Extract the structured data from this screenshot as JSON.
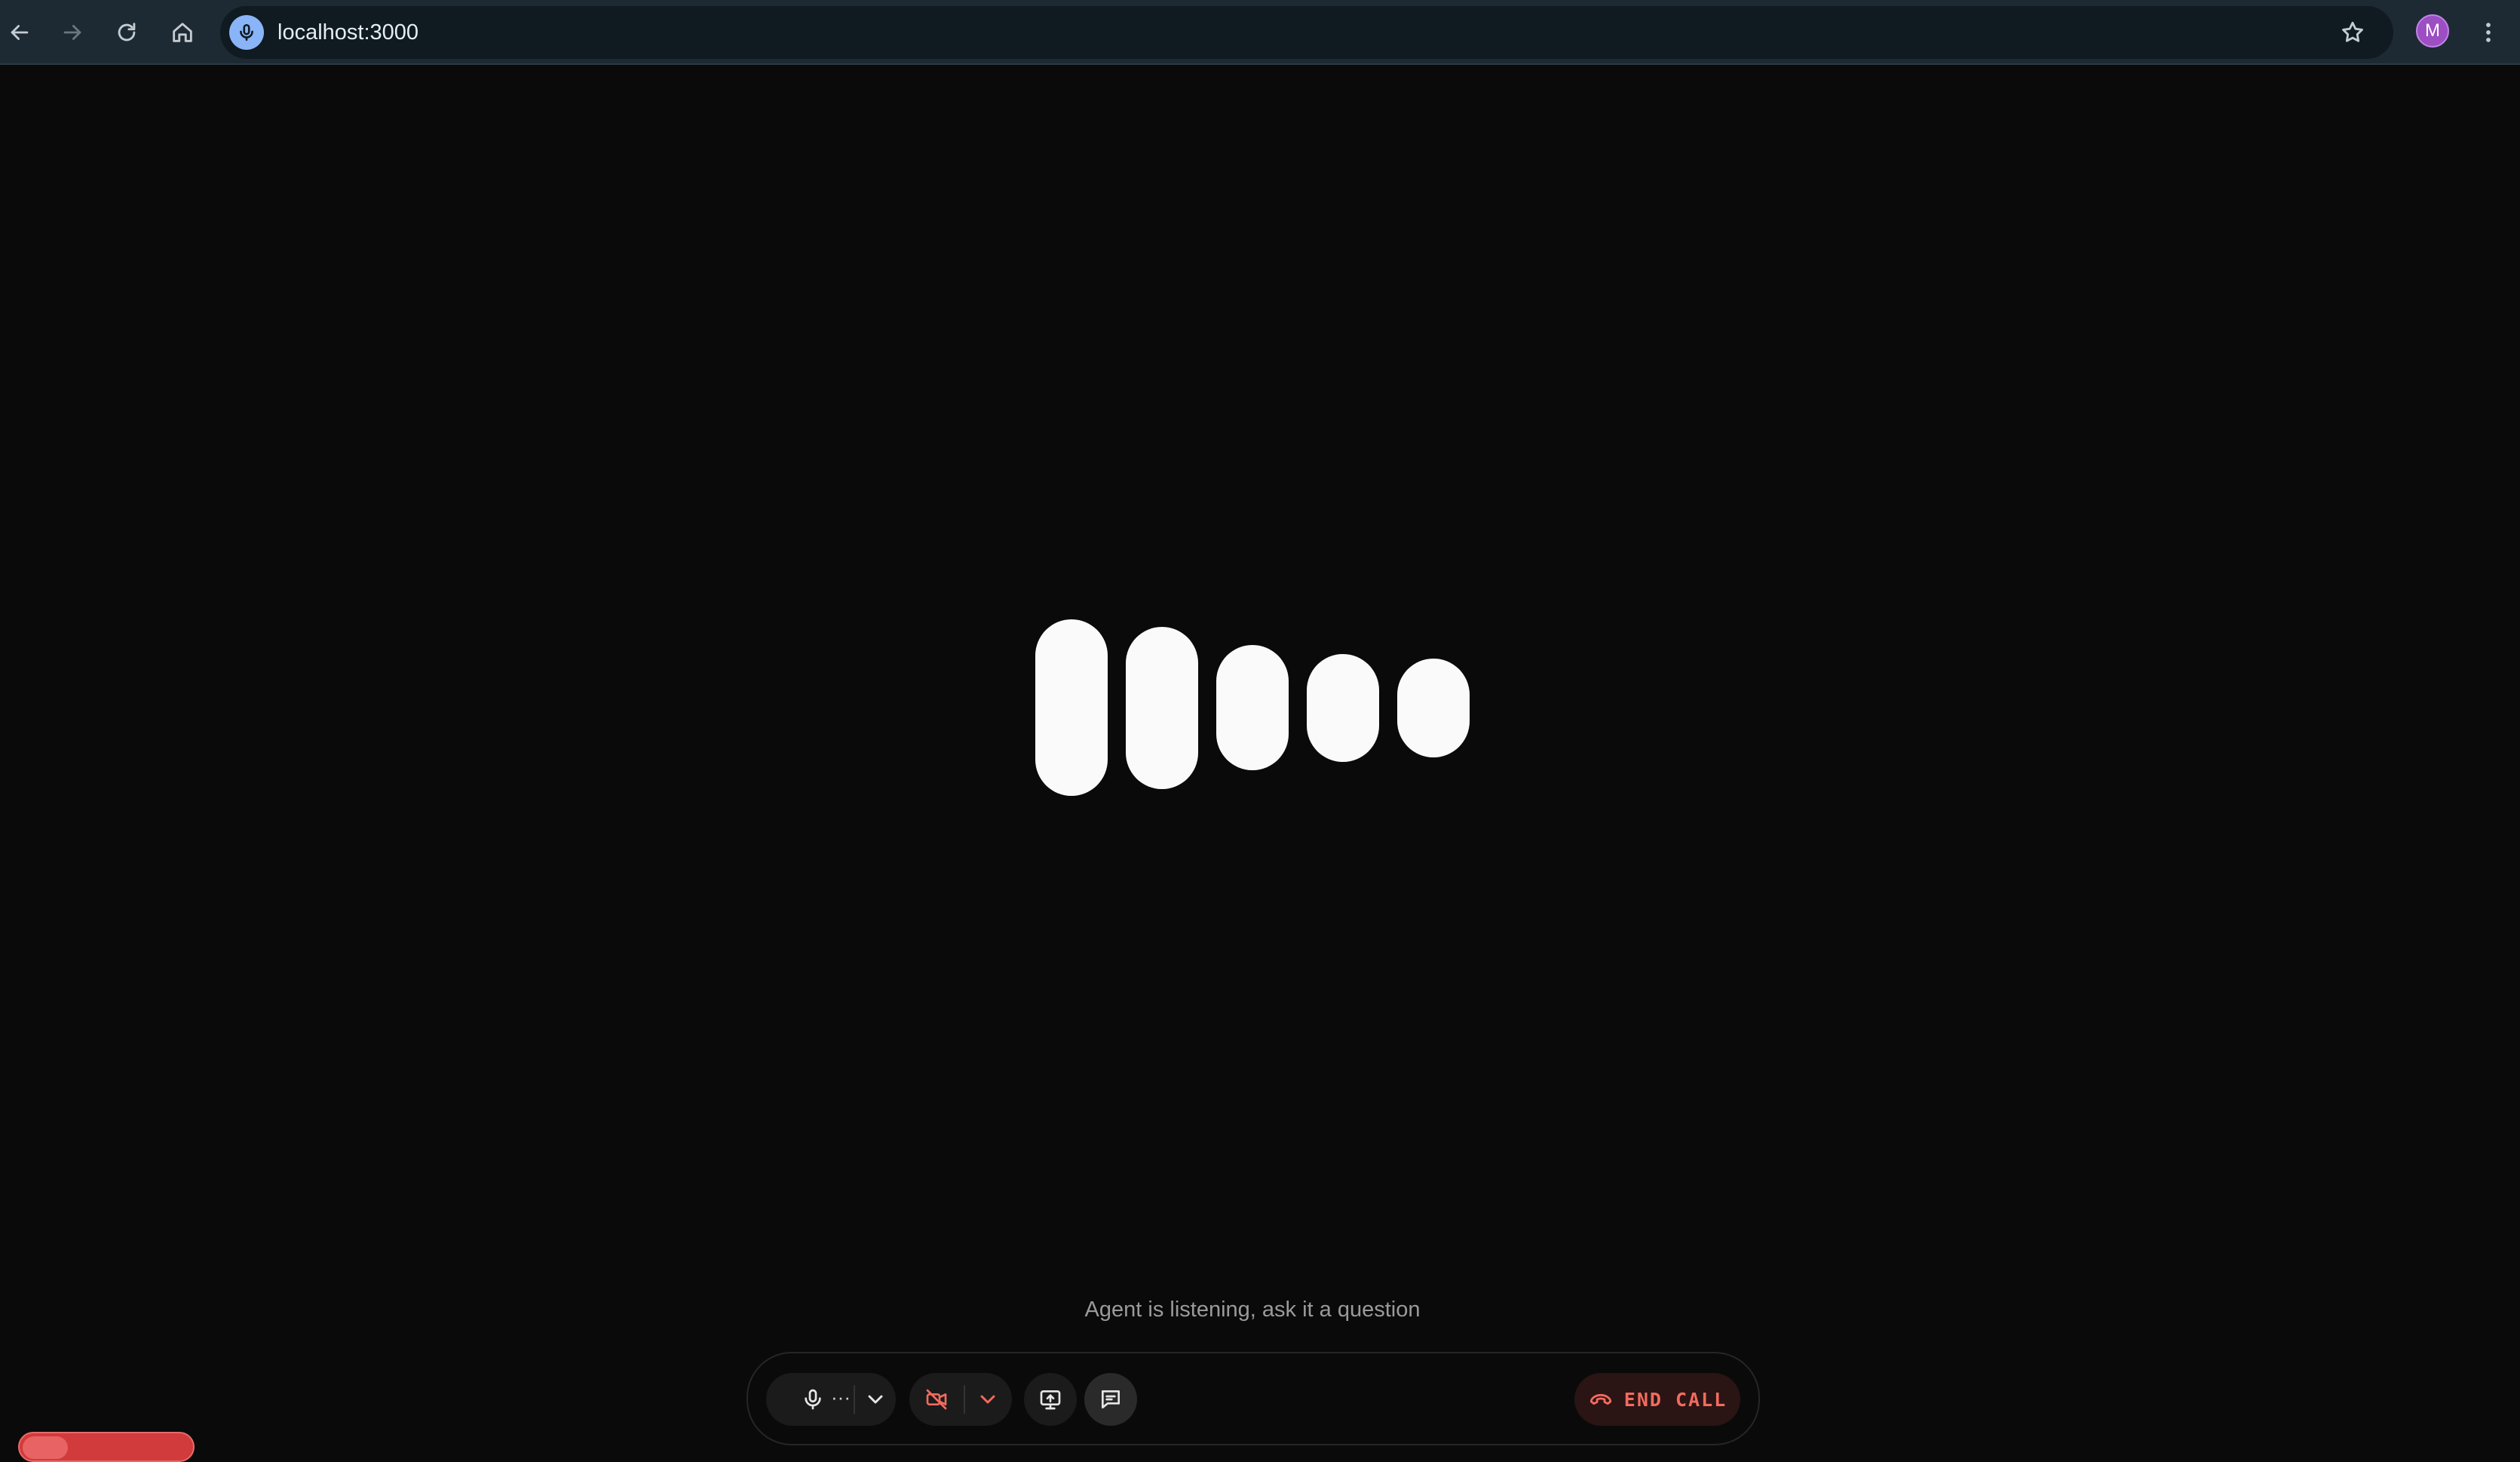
{
  "browser": {
    "url": "localhost:3000",
    "profile_initial": "M",
    "icons": {
      "back": "arrow-left-icon",
      "forward": "arrow-right-icon",
      "reload": "reload-icon",
      "home": "home-icon",
      "site": "microphone-icon",
      "bookmark": "star-icon",
      "menu": "kebab-menu-icon"
    }
  },
  "agent": {
    "status_text": "Agent is listening, ask it a question",
    "visualizer_levels": [
      1.0,
      0.92,
      0.71,
      0.61,
      0.56
    ]
  },
  "controls": {
    "mic_more": "···",
    "end_call_label": "END CALL",
    "icons": {
      "microphone": "microphone-icon",
      "mic_dropdown": "chevron-down-icon",
      "camera_off": "camera-off-icon",
      "camera_dropdown": "chevron-down-icon",
      "screen_share": "screen-share-icon",
      "chat": "chat-icon",
      "end_call": "phone-hangup-icon"
    },
    "colors": {
      "end_call_text": "#f26b5e",
      "end_call_bg": "#2a1414",
      "camera_off": "#f26b5e"
    }
  },
  "colors": {
    "background": "#0a0a0a",
    "visualizer_bar": "#fafafa",
    "chrome_bg": "#1e2a33",
    "avatar_bg": "#9c4ec2"
  }
}
